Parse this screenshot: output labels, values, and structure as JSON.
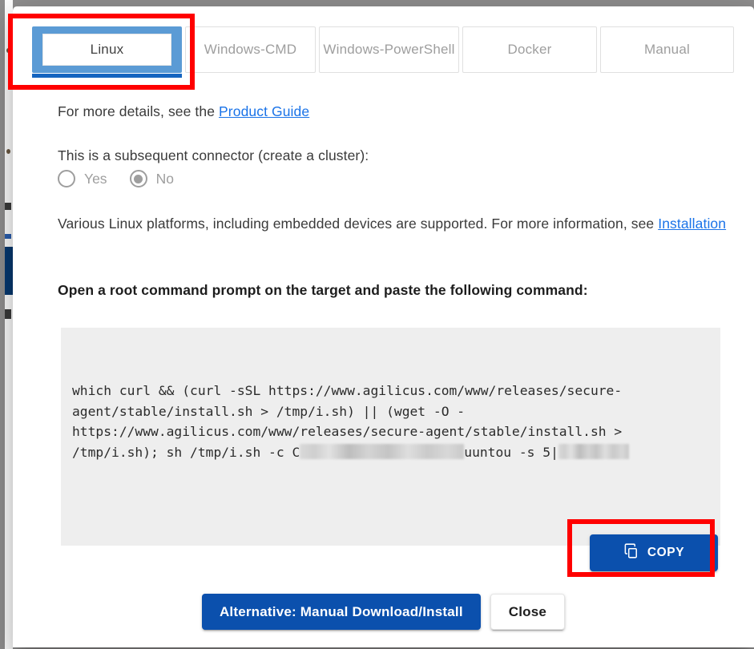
{
  "dialog": {
    "tabs": [
      {
        "id": "linux",
        "label": "Linux",
        "selected": true
      },
      {
        "id": "windows-cmd",
        "label": "Windows-CMD",
        "selected": false
      },
      {
        "id": "windows-ps",
        "label": "Windows-PowerShell",
        "selected": false
      },
      {
        "id": "docker",
        "label": "Docker",
        "selected": false
      },
      {
        "id": "manual",
        "label": "Manual",
        "selected": false
      }
    ],
    "details_line": {
      "text": "For more details, see the ",
      "link_label": "Product Guide"
    },
    "cluster_question": "This is a subsequent connector (create a cluster):",
    "radio_options": [
      {
        "label": "Yes",
        "checked": false
      },
      {
        "label": "No",
        "checked": true
      }
    ],
    "platform_note": {
      "text": "Various Linux platforms, including embedded devices are supported. For more information, see ",
      "link_label": "Installation"
    },
    "instruction": "Open a root command prompt on the target and paste the following command:",
    "command": {
      "part1": "which curl && (curl -sSL https://www.agilicus.com/www/releases/secure-agent/stable/install.sh > /tmp/i.sh) || (wget -O - https://www.agilicus.com/www/releases/secure-agent/stable/install.sh > /tmp/i.sh); sh /tmp/i.sh -c C",
      "part2": "uuntou -s 5",
      "caret": "|"
    },
    "copy_button": {
      "label": "COPY",
      "icon": "copy-icon",
      "color": "#0b50ad"
    },
    "footer": {
      "primary_label": "Alternative: Manual Download/Install",
      "secondary_label": "Close",
      "primary_color": "#0b50ad"
    }
  },
  "annotations": {
    "color": "#ff0000",
    "boxes": [
      {
        "target": "tab-linux",
        "label": "Linux"
      },
      {
        "target": "copy-button",
        "label": "COPY"
      }
    ]
  }
}
